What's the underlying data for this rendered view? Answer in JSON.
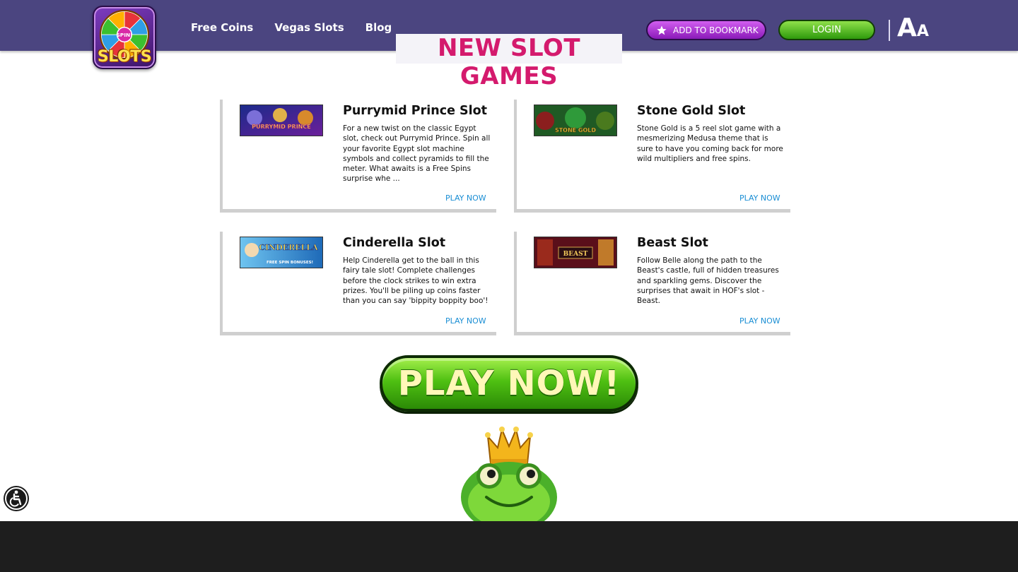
{
  "header": {
    "logo_text": "SLOTS",
    "logo_badge": "SPIN!",
    "nav": [
      {
        "label": "Free Coins"
      },
      {
        "label": "Vegas Slots"
      },
      {
        "label": "Blog"
      }
    ],
    "bookmark_label": "ADD TO BOOKMARK",
    "login_label": "LOGIN",
    "font_size_big": "A",
    "font_size_small": "A"
  },
  "section": {
    "title": "NEW SLOT GAMES"
  },
  "games": [
    {
      "title": "Purrymid Prince Slot",
      "thumb_text": "PURRYMID PRINCE",
      "description": "For a new twist on the classic Egypt slot, check out Purrymid Prince. Spin all your favorite Egypt slot machine symbols and collect pyramids to fill the meter. What awaits is a Free Spins surprise whe ...",
      "play_label": "PLAY NOW"
    },
    {
      "title": "Stone Gold Slot",
      "thumb_text": "STONE GOLD",
      "description": "Stone Gold is a 5 reel slot game with a mesmerizing Medusa theme that is sure to have you coming back for more wild multipliers and free spins.",
      "play_label": "PLAY NOW"
    },
    {
      "title": "Cinderella Slot",
      "thumb_text": "CINDERELLA",
      "thumb_sub": "FREE SPIN BONUSES!",
      "description": "Help Cinderella get to the ball in this fairy tale slot! Complete challenges before the clock strikes to win extra prizes. You'll be piling up coins faster than you can say 'bippity boppity boo'!",
      "play_label": "PLAY NOW"
    },
    {
      "title": "Beast Slot",
      "thumb_text": "BEAST",
      "description": "Follow Belle along the path to the Beast's castle, full of hidden treasures and sparkling gems. Discover the surprises that await in HOF's slot - Beast.",
      "play_label": "PLAY NOW"
    }
  ],
  "cta": {
    "play_label": "PLAY NOW!"
  },
  "colors": {
    "header_bg": "#4b4580",
    "title_pink": "#d41a6d",
    "link_blue": "#1a8ed4",
    "cta_green": "#4fc012",
    "footer_bg": "#1e1e1e"
  },
  "icons": {
    "bookmark": "star-icon",
    "font_size": "font-size-icon",
    "accessibility": "accessibility-icon",
    "mascot": "frog-prince-mascot"
  }
}
